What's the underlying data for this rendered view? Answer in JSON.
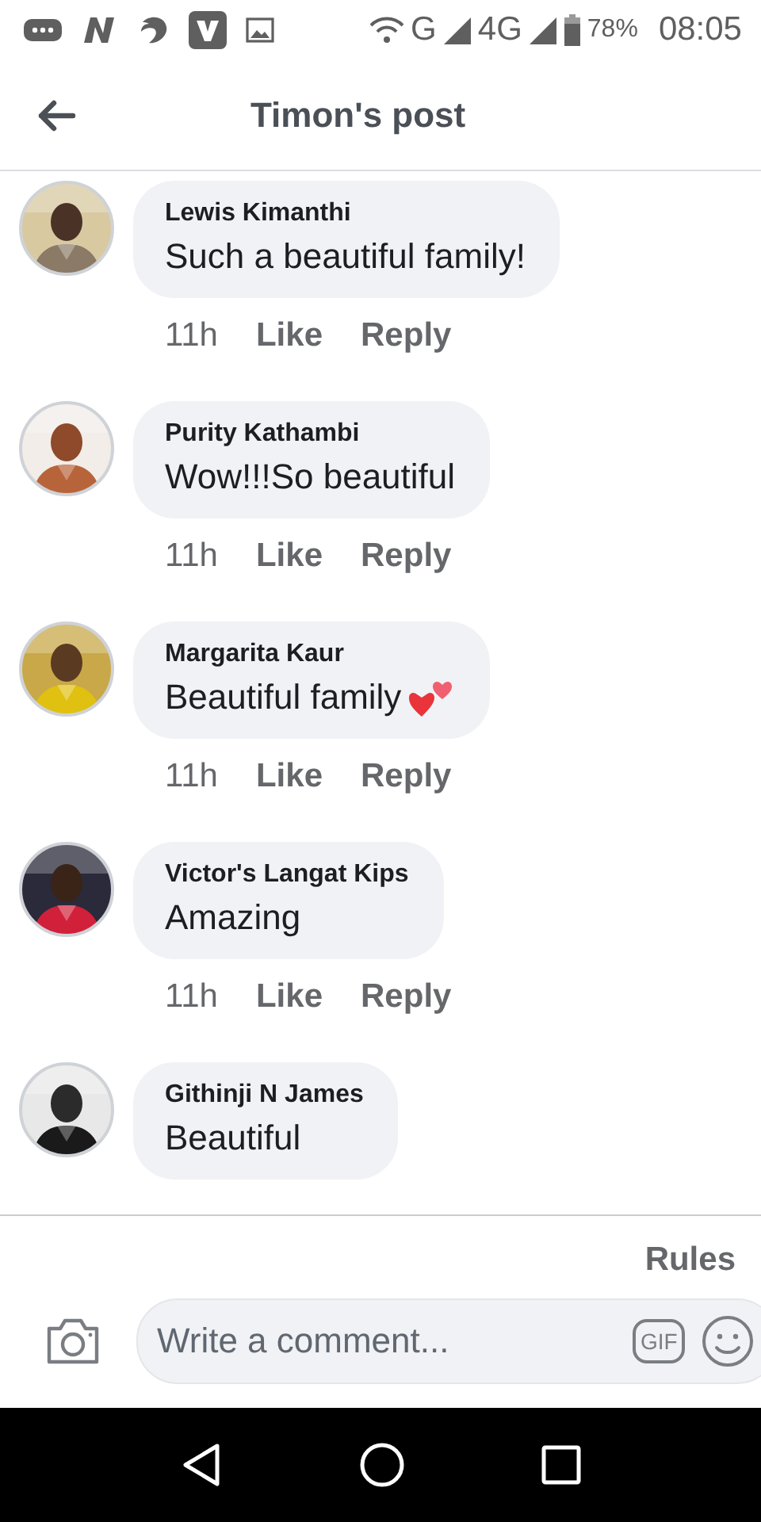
{
  "status_bar": {
    "battery": "78%",
    "time": "08:05",
    "network_1": "G",
    "network_2": "4G"
  },
  "header": {
    "title": "Timon's post"
  },
  "comments": [
    {
      "author": "Lewis Kimanthi",
      "text": "Such a beautiful family!",
      "time": "11h",
      "like": "Like",
      "reply": "Reply",
      "hearts": false
    },
    {
      "author": "Purity Kathambi",
      "text": "Wow!!!So beautiful",
      "time": "11h",
      "like": "Like",
      "reply": "Reply",
      "hearts": false
    },
    {
      "author": "Margarita Kaur",
      "text": "Beautiful family",
      "time": "11h",
      "like": "Like",
      "reply": "Reply",
      "hearts": true
    },
    {
      "author": "Victor's Langat Kips",
      "text": "Amazing",
      "time": "11h",
      "like": "Like",
      "reply": "Reply",
      "hearts": false
    },
    {
      "author": "Githinji N James",
      "text": "Beautiful"
    }
  ],
  "rules_link": "Rules",
  "composer": {
    "placeholder": "Write a comment...",
    "gif": "GIF"
  }
}
